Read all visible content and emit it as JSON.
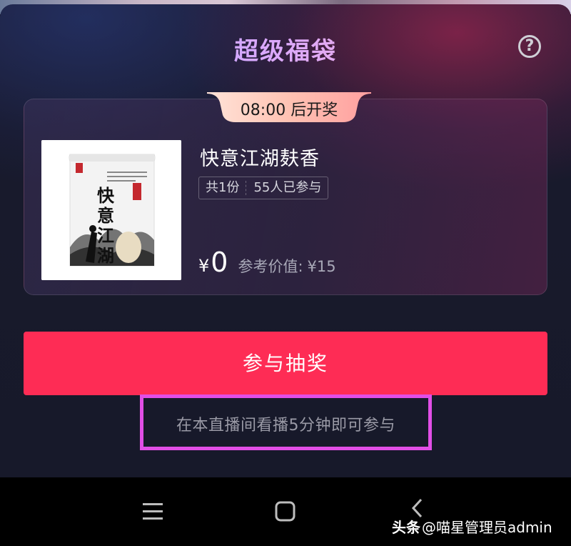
{
  "sheet": {
    "title": "超级福袋",
    "help_icon": "question-circle-icon",
    "help_glyph": "?"
  },
  "prize": {
    "countdown": "08:00 后开奖",
    "name": "快意江湖麸香",
    "image_brand_text": "快意江湖",
    "tags": [
      "共1份",
      "55人已参与"
    ],
    "currency": "¥",
    "price": "0",
    "ref_label": "参考价值:",
    "ref_value": "¥15"
  },
  "actions": {
    "join_label": "参与抽奖",
    "condition": "在本直播间看播5分钟即可参与"
  },
  "navigation": {
    "buttons": [
      "menu-icon",
      "home-icon",
      "back-icon"
    ]
  },
  "watermark": {
    "platform": "头条",
    "handle": "@喵星管理员admin"
  },
  "colors": {
    "primary_button": "#fe2c55",
    "highlight_border": "#e14ee6",
    "countdown_badge": "#ffb9a6"
  }
}
